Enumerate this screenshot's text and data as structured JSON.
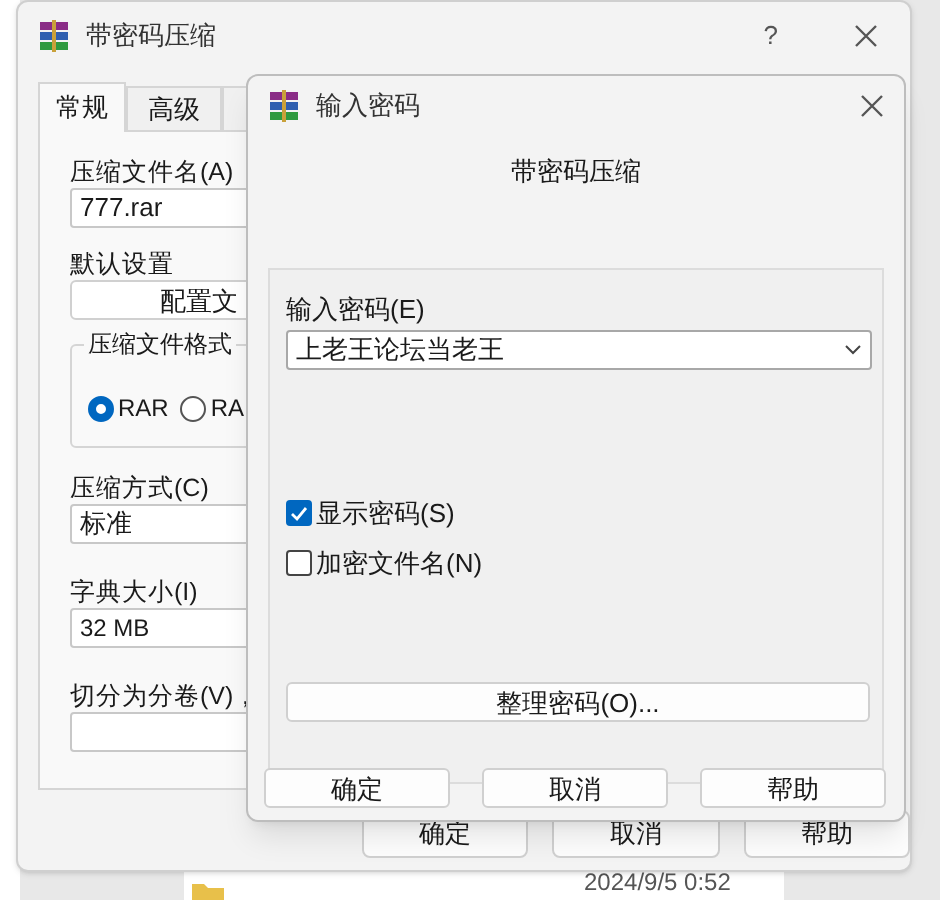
{
  "background": {
    "file_date": "2024/9/5 0:52"
  },
  "back_dialog": {
    "title": "带密码压缩",
    "help": "?",
    "tabs": [
      {
        "label": "常规",
        "selected": true
      },
      {
        "label": "高级",
        "selected": false
      }
    ],
    "archive_name_label": "压缩文件名(A)",
    "archive_name": "777.rar",
    "default_settings_label": "默认设置",
    "profiles_button": "配置文",
    "format_group": {
      "label": "压缩文件格式",
      "options": [
        {
          "label": "RAR",
          "selected": true
        },
        {
          "label": "RA",
          "selected": false
        }
      ]
    },
    "method_label": "压缩方式(C)",
    "method": "标准",
    "dictionary_label": "字典大小(I)",
    "dictionary": "32 MB",
    "split_label": "切分为分卷(V)，",
    "buttons": [
      "确定",
      "取消",
      "帮助"
    ]
  },
  "password_dialog": {
    "title": "输入密码",
    "heading": "带密码压缩",
    "password_label": "输入密码(E)",
    "password": "上老王论坛当老王",
    "options": [
      {
        "label": "显示密码(S)",
        "checked": true
      },
      {
        "label": "加密文件名(N)",
        "checked": false
      }
    ],
    "organize_button": "整理密码(O)...",
    "buttons": [
      "确定",
      "取消",
      "帮助"
    ]
  }
}
